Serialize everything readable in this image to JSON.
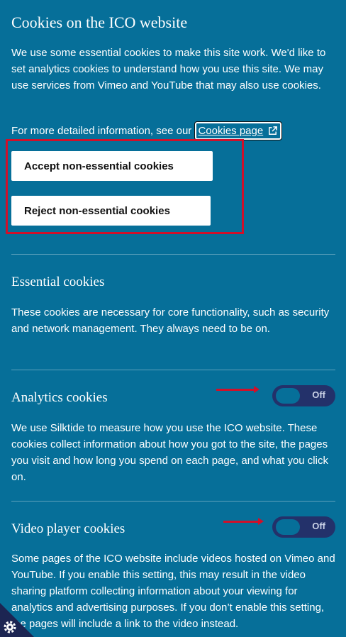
{
  "banner": {
    "title": "Cookies on the ICO website",
    "intro": "We use some essential cookies to make this site work. We'd like to set analytics cookies to understand how you use this site. We may use services from Vimeo and YouTube that may also use cookies.",
    "more_info_prefix": "For more detailed information, see our",
    "cookies_link_label": "Cookies page",
    "accept_label": "Accept non-essential cookies",
    "reject_label": "Reject non-essential cookies"
  },
  "sections": [
    {
      "title": "Essential cookies",
      "description": "These cookies are necessary for core functionality, such as security and network management. They always need to be on."
    },
    {
      "title": "Analytics cookies",
      "description": "We use Silktide to measure how you use the ICO website. These cookies collect information about how you got to the site, the pages you visit and how long you spend on each page, and what you click on.",
      "toggle_label": "Off",
      "enabled": false
    },
    {
      "title": "Video player cookies",
      "description": "Some pages of the ICO website include videos hosted on Vimeo and YouTube. If you enable this setting, this may result in the video sharing platform collecting information about your viewing for analytics and advertising purposes. If you don’t enable this setting, the pages will include a link to the video instead.",
      "toggle_label": "Off",
      "enabled": false
    }
  ],
  "colors": {
    "background": "#066f99",
    "toggle_track": "#23316a",
    "annotation_red": "#d0102a",
    "button_bg": "#ffffff"
  },
  "icons": [
    "external-link-icon",
    "gear-icon"
  ]
}
